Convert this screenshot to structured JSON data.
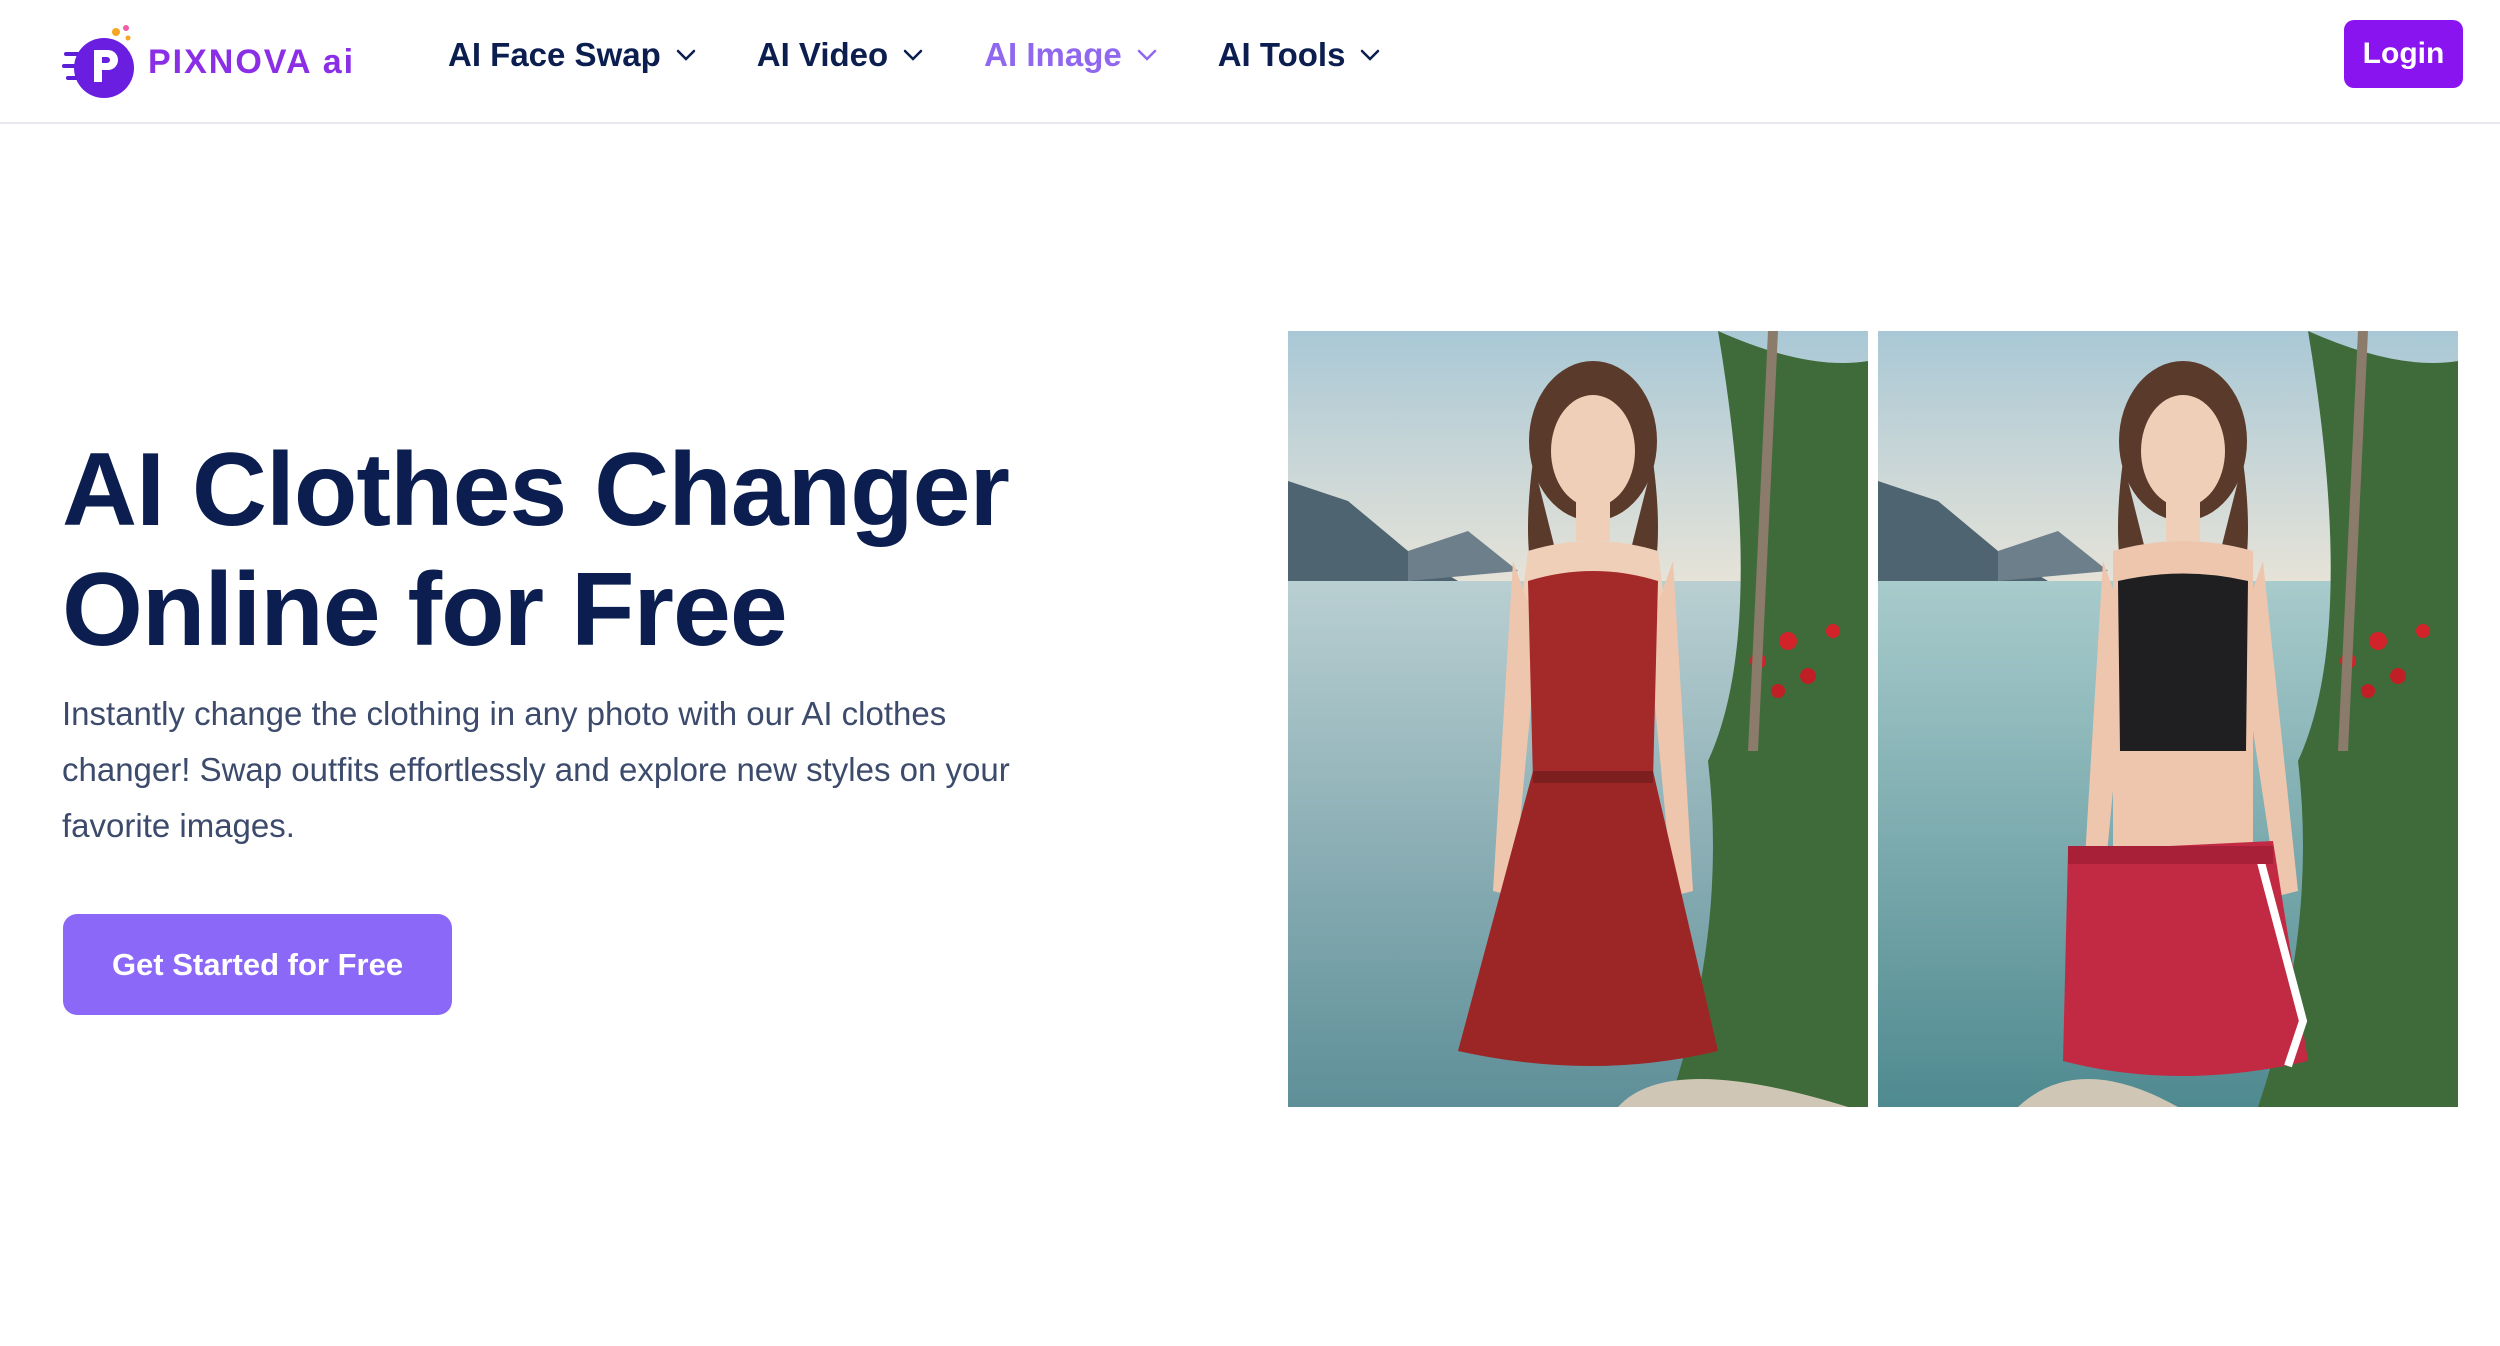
{
  "header": {
    "logo_text": "PIXNOVA ai",
    "nav": [
      {
        "label": "AI Face Swap",
        "active": false
      },
      {
        "label": "AI Video",
        "active": false
      },
      {
        "label": "AI Image",
        "active": true
      },
      {
        "label": "AI Tools",
        "active": false
      }
    ],
    "login_label": "Login"
  },
  "hero": {
    "title_line1": "AI Clothes Changer",
    "title_line2": "Online for Free",
    "description": "Instantly change the clothing in any photo with our AI clothes changer! Swap outfits effortlessly and explore new styles on your favorite images.",
    "cta_label": "Get Started for Free"
  },
  "images": {
    "before": {
      "outfit": "red sundress"
    },
    "after": {
      "outfit": "black crop top and red skirt"
    }
  },
  "colors": {
    "brand": "#8a14f0",
    "nav_active": "#9068f0",
    "cta": "#8b68f7",
    "heading": "#0b1e4f",
    "body_text": "#3c4a6b"
  },
  "icons": {
    "chevron": "chevron-down-icon",
    "logo": "pixnova-logo-icon"
  }
}
